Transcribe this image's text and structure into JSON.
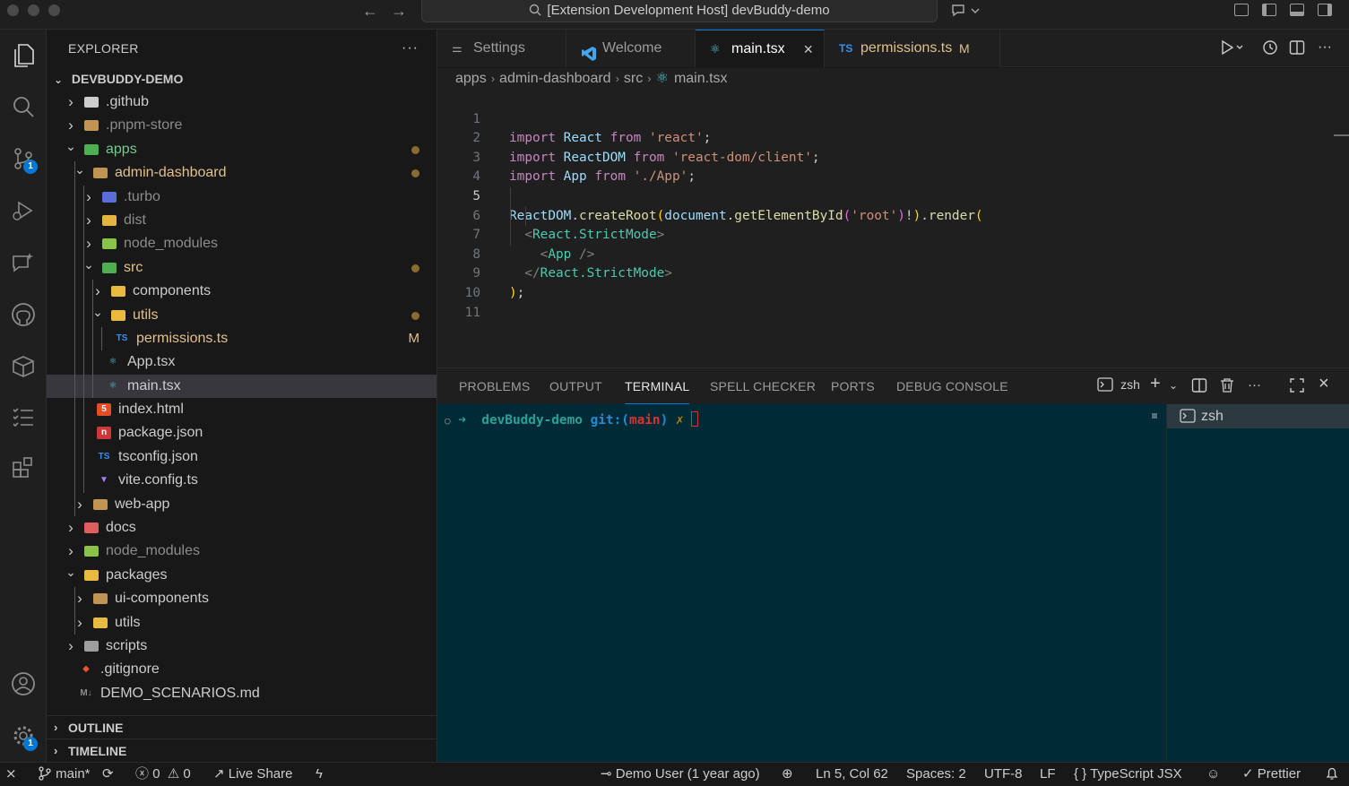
{
  "window": {
    "title": "[Extension Development Host] devBuddy-demo"
  },
  "activity_bar": {
    "items": [
      {
        "name": "explorer-icon"
      },
      {
        "name": "search-icon"
      },
      {
        "name": "source-control-icon",
        "badge": "1"
      },
      {
        "name": "run-debug-icon"
      },
      {
        "name": "chat-sparkle-icon"
      },
      {
        "name": "github-icon"
      },
      {
        "name": "package-box-icon"
      },
      {
        "name": "checklist-icon"
      },
      {
        "name": "extensions-icon"
      }
    ],
    "bottom": [
      {
        "name": "account-icon"
      },
      {
        "name": "settings-gear-icon",
        "badge": "1"
      }
    ]
  },
  "explorer": {
    "title": "EXPLORER",
    "more": "···",
    "root": "DEVBUDDY-DEMO",
    "tree": [
      {
        "label": ".github",
        "icon": "github-folder-icon",
        "depth": 0,
        "expanded": false,
        "dimmed": false
      },
      {
        "label": ".pnpm-store",
        "icon": "folder-icon",
        "depth": 0,
        "expanded": false,
        "dimmed": true
      },
      {
        "label": "apps",
        "icon": "apps-folder-icon",
        "depth": 0,
        "expanded": true,
        "dot": true,
        "color": "#73c991"
      },
      {
        "label": "admin-dashboard",
        "icon": "folder-icon",
        "depth": 1,
        "expanded": true,
        "dot": true,
        "color": "#e2c08d"
      },
      {
        "label": ".turbo",
        "icon": "turbo-folder-icon",
        "depth": 2,
        "expanded": false,
        "dimmed": true
      },
      {
        "label": "dist",
        "icon": "dist-folder-icon",
        "depth": 2,
        "expanded": false,
        "dimmed": true
      },
      {
        "label": "node_modules",
        "icon": "node-modules-folder-icon",
        "depth": 2,
        "expanded": false,
        "dimmed": true
      },
      {
        "label": "src",
        "icon": "src-folder-icon",
        "depth": 2,
        "expanded": true,
        "dot": true,
        "color": "#e2c08d"
      },
      {
        "label": "components",
        "icon": "components-folder-icon",
        "depth": 3,
        "expanded": false
      },
      {
        "label": "utils",
        "icon": "utils-folder-icon",
        "depth": 3,
        "expanded": true,
        "dot": true,
        "color": "#e2c08d"
      },
      {
        "label": "permissions.ts",
        "icon": "typescript-file-icon",
        "depth": 4,
        "file": true,
        "flag": "M",
        "color": "#e2c08d"
      },
      {
        "label": "App.tsx",
        "icon": "react-file-icon",
        "depth": 3,
        "file": true
      },
      {
        "label": "main.tsx",
        "icon": "react-file-icon",
        "depth": 3,
        "file": true,
        "selected": true
      },
      {
        "label": "index.html",
        "icon": "html-file-icon",
        "depth": 2,
        "file": true
      },
      {
        "label": "package.json",
        "icon": "npm-file-icon",
        "depth": 2,
        "file": true
      },
      {
        "label": "tsconfig.json",
        "icon": "tsconfig-file-icon",
        "depth": 2,
        "file": true
      },
      {
        "label": "vite.config.ts",
        "icon": "vite-file-icon",
        "depth": 2,
        "file": true
      },
      {
        "label": "web-app",
        "icon": "folder-icon",
        "depth": 1,
        "expanded": false
      },
      {
        "label": "docs",
        "icon": "docs-folder-icon",
        "depth": 0,
        "expanded": false
      },
      {
        "label": "node_modules",
        "icon": "node-modules-folder-icon",
        "depth": 0,
        "expanded": false,
        "dimmed": true
      },
      {
        "label": "packages",
        "icon": "packages-folder-icon",
        "depth": 0,
        "expanded": true
      },
      {
        "label": "ui-components",
        "icon": "folder-icon",
        "depth": 1,
        "expanded": false
      },
      {
        "label": "utils",
        "icon": "utils-folder-icon",
        "depth": 1,
        "expanded": false
      },
      {
        "label": "scripts",
        "icon": "scripts-folder-icon",
        "depth": 0,
        "expanded": false
      },
      {
        "label": ".gitignore",
        "icon": "git-file-icon",
        "depth": 0,
        "file": true
      },
      {
        "label": "DEMO_SCENARIOS.md",
        "icon": "markdown-file-icon",
        "depth": 0,
        "file": true
      }
    ],
    "sections": [
      "OUTLINE",
      "TIMELINE"
    ]
  },
  "tabs": [
    {
      "label": "Settings",
      "icon": "settings-icon",
      "active": false
    },
    {
      "label": "Welcome",
      "icon": "vscode-icon",
      "active": false
    },
    {
      "label": "main.tsx",
      "icon": "react-icon",
      "active": true
    },
    {
      "label": "permissions.ts",
      "icon": "TS",
      "active": false,
      "flag": "M"
    }
  ],
  "breadcrumb": [
    "apps",
    "admin-dashboard",
    "src",
    "main.tsx"
  ],
  "code": {
    "current_line": 5,
    "line_numbers": [
      "1",
      "2",
      "3",
      "4",
      "5",
      "6",
      "7",
      "8",
      "9",
      "10",
      "11"
    ],
    "line1": {
      "a": "import",
      "b": "React",
      "c": "from",
      "d": "'react'",
      "e": ";"
    },
    "line2": {
      "a": "import",
      "b": "ReactDOM",
      "c": "from",
      "d": "'react-dom/client'",
      "e": ";"
    },
    "line3": {
      "a": "import",
      "b": "App",
      "c": "from",
      "d": "'./App'",
      "e": ";"
    },
    "line5": {
      "a": "ReactDOM",
      "b": ".",
      "c": "createRoot",
      "d": "(",
      "e": "document",
      "f": ".",
      "g": "getElementById",
      "h": "(",
      "i": "'root'",
      "j": ")",
      "k": "!",
      "l": ")",
      "m": ".",
      "n": "render",
      "o": "("
    },
    "line6": {
      "a": "<",
      "b": "React.StrictMode",
      "c": ">"
    },
    "line7": {
      "a": "<",
      "b": "App",
      "c": " />"
    },
    "line8": {
      "a": "</",
      "b": "React.StrictMode",
      "c": ">"
    },
    "line9": {
      "a": ")",
      "b": ";"
    }
  },
  "panel": {
    "tabs": [
      "PROBLEMS",
      "OUTPUT",
      "TERMINAL",
      "SPELL CHECKER",
      "PORTS",
      "DEBUG CONSOLE"
    ],
    "active_tab": "TERMINAL",
    "shell_label": "zsh",
    "terminal": {
      "prompt_arrow": "➜",
      "dir": "devBuddy-demo",
      "git_label": "git:(",
      "branch": "main",
      "git_close": ")",
      "dirty": "✗"
    },
    "terminal_list": [
      "zsh"
    ]
  },
  "status_bar": {
    "branch": "main*",
    "errors": "0",
    "warnings": "0",
    "live_share": "Live Share",
    "blame": "Demo User (1 year ago)",
    "cursor": "Ln 5, Col 62",
    "spaces": "Spaces: 2",
    "encoding": "UTF-8",
    "eol": "LF",
    "language": "TypeScript JSX",
    "formatter": "Prettier"
  }
}
